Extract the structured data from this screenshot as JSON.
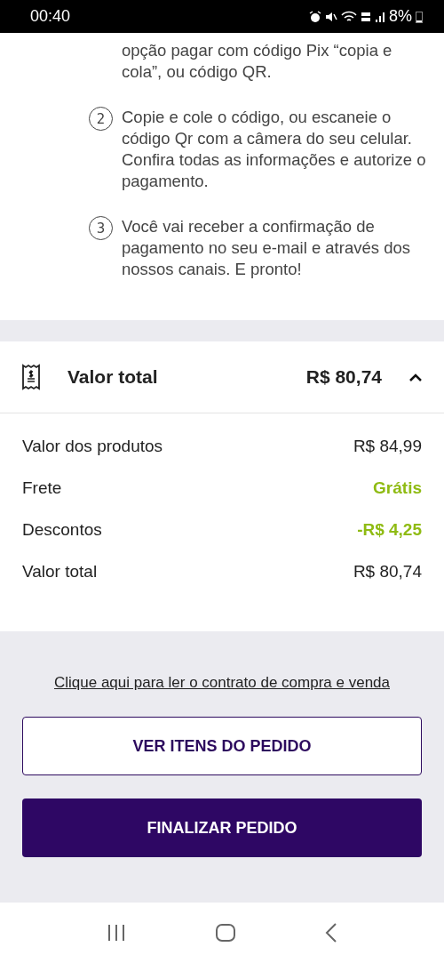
{
  "status_bar": {
    "time": "00:40",
    "battery": "8%"
  },
  "steps": [
    {
      "text": "opção pagar com código Pix “copia e cola”, ou código QR."
    },
    {
      "number": "2",
      "text": "Copie e cole o código, ou escaneie o código Qr com a câmera do seu celular. Confira todas as informações e autorize o pagamento."
    },
    {
      "number": "3",
      "text": "Você vai receber a confirmação de pagamento no seu e-mail e através dos nossos canais. E pronto!"
    }
  ],
  "summary": {
    "title": "Valor total",
    "total": "R$ 80,74",
    "expanded": true,
    "rows": [
      {
        "label": "Valor dos produtos",
        "value": "R$ 84,99",
        "highlight": false
      },
      {
        "label": "Frete",
        "value": "Grátis",
        "highlight": true
      },
      {
        "label": "Descontos",
        "value": "-R$ 4,25",
        "highlight": true
      },
      {
        "label": "Valor total",
        "value": "R$ 80,74",
        "highlight": false
      }
    ]
  },
  "contract_link": "Clique aqui para ler o contrato de compra e venda",
  "buttons": [
    {
      "label": "VER ITENS DO PEDIDO",
      "kind": "outline"
    },
    {
      "label": "FINALIZAR PEDIDO",
      "kind": "primary"
    }
  ]
}
